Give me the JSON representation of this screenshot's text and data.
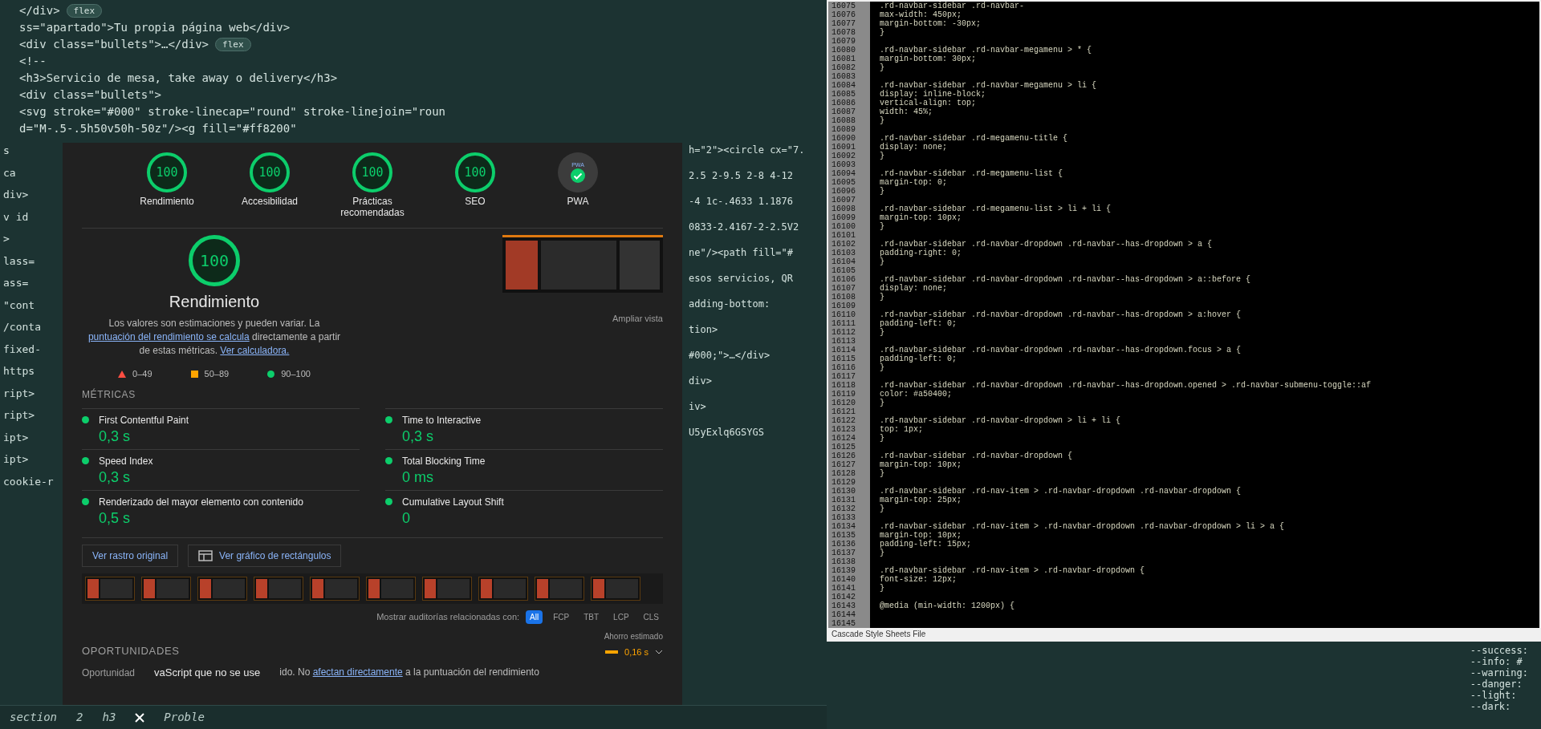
{
  "background_editor": {
    "top_lines": [
      {
        "code": "</div>",
        "badge": "flex"
      },
      {
        "code": "ss=\"apartado\">Tu propia página web</div>"
      },
      {
        "code": "<div class=\"bullets\">…</div>",
        "badge": "flex"
      },
      {
        "code": "<!--"
      },
      {
        "code": "<h3>Servicio de mesa, take away o delivery</h3>"
      },
      {
        "code": "<div class=\"bullets\">"
      },
      {
        "code": "<svg stroke=\"#000\" stroke-linecap=\"round\" stroke-linejoin=\"roun"
      },
      {
        "code": "d=\"M-.5-.5h50v50h-50z\"/><g fill=\"#ff8200\""
      }
    ],
    "left_fragments": [
      "s",
      "ca",
      "div>",
      "v id",
      ">",
      "lass=",
      "ass=",
      "\"cont",
      "/conta",
      "fixed-",
      "https",
      "ript>",
      "ript>",
      "ipt>",
      "ipt>",
      "cookie-r"
    ],
    "middle_fragments": [
      "h=\"2\"><circle cx=\"7.",
      "2.5 2-9.5 2-8 4-12",
      "-4 1c-.4633 1.1876",
      "0833-2.4167-2-2.5V2",
      "ne\"/><path fill=\"#",
      "esos servicios, QR",
      "adding-bottom:",
      "tion>",
      "#000;\">…</div>",
      "div>",
      "iv>",
      "U5yExlq6GSYGS"
    ],
    "bottom_bar": {
      "crumbs": [
        "section",
        "2",
        "h3"
      ],
      "panel_tab": "Proble"
    },
    "css_vars": [
      "--success:",
      "--info: #",
      "--warning:",
      "--danger:",
      "--light:",
      "--dark:"
    ]
  },
  "lighthouse": {
    "gauges": [
      {
        "kind": "score",
        "score": "100",
        "label": "Rendimiento"
      },
      {
        "kind": "score",
        "score": "100",
        "label": "Accesibilidad"
      },
      {
        "kind": "score",
        "score": "100",
        "label": "Prácticas recomendadas"
      },
      {
        "kind": "score",
        "score": "100",
        "label": "SEO"
      },
      {
        "kind": "pwa",
        "badge": "PWA",
        "label": "PWA"
      }
    ],
    "main": {
      "score": "100",
      "title": "Rendimiento",
      "description": [
        {
          "text": "Los valores son estimaciones y pueden variar. La ",
          "link": false
        },
        {
          "text": "puntuación del rendimiento se calcula",
          "link": true
        },
        {
          "text": " directamente a partir de estas métricas. ",
          "link": false
        },
        {
          "text": "Ver calculadora.",
          "link": true
        }
      ],
      "legend": [
        {
          "kind": "fail",
          "range": "0–49"
        },
        {
          "kind": "average",
          "range": "50–89"
        },
        {
          "kind": "pass",
          "range": "90–100"
        }
      ],
      "expand_link": "Ampliar vista"
    },
    "metrics_heading": "MÉTRICAS",
    "metrics": [
      {
        "label": "First Contentful Paint",
        "value": "0,3 s",
        "color": "#0cce6b"
      },
      {
        "label": "Time to Interactive",
        "value": "0,3 s",
        "color": "#0cce6b"
      },
      {
        "label": "Speed Index",
        "value": "0,3 s",
        "color": "#0cce6b"
      },
      {
        "label": "Total Blocking Time",
        "value": "0 ms",
        "color": "#0cce6b"
      },
      {
        "label": "Renderizado del mayor elemento con contenido",
        "value": "0,5 s",
        "color": "#0cce6b"
      },
      {
        "label": "Cumulative Layout Shift",
        "value": "0",
        "color": "#0cce6b"
      }
    ],
    "buttons": [
      {
        "label": "Ver rastro original",
        "kind": "plain"
      },
      {
        "label": "Ver gráfico de rectángulos",
        "kind": "treemap"
      }
    ],
    "filter_label": "Mostrar auditorías relacionadas con:",
    "filters": [
      {
        "label": "All",
        "selected": true
      },
      {
        "label": "FCP",
        "selected": false
      },
      {
        "label": "TBT",
        "selected": false
      },
      {
        "label": "LCP",
        "selected": false
      },
      {
        "label": "CLS",
        "selected": false
      }
    ],
    "savings_heading": "Ahorro estimado",
    "savings_value": "0,16 s",
    "opportunities_heading": "OPORTUNIDADES",
    "column_heading": "Oportunidad",
    "audit_title": "vaScript que no se use",
    "audit_note": [
      {
        "text": "ido. No ",
        "link": false
      },
      {
        "text": "afectan directamente",
        "link": true
      },
      {
        "text": " a la puntuación del rendimiento",
        "link": false
      }
    ]
  },
  "css_editor": {
    "lines": [
      {
        "n": "16075",
        "code": ".rd-navbar-sidebar .rd-navbar-"
      },
      {
        "n": "16076",
        "code": "max-width: 450px;"
      },
      {
        "n": "16077",
        "code": "margin-bottom: -30px;"
      },
      {
        "n": "16078",
        "code": "}"
      },
      {
        "n": "16079"
      },
      {
        "n": "16080",
        "code": ".rd-navbar-sidebar .rd-navbar-megamenu > * {"
      },
      {
        "n": "16081",
        "code": "margin-bottom: 30px;"
      },
      {
        "n": "16082",
        "code": "}"
      },
      {
        "n": "16083"
      },
      {
        "n": "16084",
        "code": ".rd-navbar-sidebar .rd-navbar-megamenu > li {"
      },
      {
        "n": "16085",
        "code": "display: inline-block;"
      },
      {
        "n": "16086",
        "code": "vertical-align: top;"
      },
      {
        "n": "16087",
        "code": "width: 45%;"
      },
      {
        "n": "16088",
        "code": "}"
      },
      {
        "n": "16089"
      },
      {
        "n": "16090",
        "code": ".rd-navbar-sidebar .rd-megamenu-title {"
      },
      {
        "n": "16091",
        "code": "display: none;"
      },
      {
        "n": "16092",
        "code": "}"
      },
      {
        "n": "16093"
      },
      {
        "n": "16094",
        "code": ".rd-navbar-sidebar .rd-megamenu-list {"
      },
      {
        "n": "16095",
        "code": "margin-top: 0;"
      },
      {
        "n": "16096",
        "code": "}"
      },
      {
        "n": "16097"
      },
      {
        "n": "16098",
        "code": ".rd-navbar-sidebar .rd-megamenu-list > li + li {"
      },
      {
        "n": "16099",
        "code": "margin-top: 10px;"
      },
      {
        "n": "16100",
        "code": "}"
      },
      {
        "n": "16101"
      },
      {
        "n": "16102",
        "code": ".rd-navbar-sidebar .rd-navbar-dropdown .rd-navbar--has-dropdown > a {"
      },
      {
        "n": "16103",
        "code": "padding-right: 0;"
      },
      {
        "n": "16104",
        "code": "}"
      },
      {
        "n": "16105"
      },
      {
        "n": "16106",
        "code": ".rd-navbar-sidebar .rd-navbar-dropdown .rd-navbar--has-dropdown > a::before {"
      },
      {
        "n": "16107",
        "code": "display: none;"
      },
      {
        "n": "16108",
        "code": "}"
      },
      {
        "n": "16109"
      },
      {
        "n": "16110",
        "code": ".rd-navbar-sidebar .rd-navbar-dropdown .rd-navbar--has-dropdown > a:hover {"
      },
      {
        "n": "16111",
        "code": "padding-left: 0;"
      },
      {
        "n": "16112",
        "code": "}"
      },
      {
        "n": "16113"
      },
      {
        "n": "16114",
        "code": ".rd-navbar-sidebar .rd-navbar-dropdown .rd-navbar--has-dropdown.focus > a {"
      },
      {
        "n": "16115",
        "code": "padding-left: 0;"
      },
      {
        "n": "16116",
        "code": "}"
      },
      {
        "n": "16117"
      },
      {
        "n": "16118",
        "code": ".rd-navbar-sidebar .rd-navbar-dropdown .rd-navbar--has-dropdown.opened > .rd-navbar-submenu-toggle::af"
      },
      {
        "n": "16119",
        "code": "color: #a50400;"
      },
      {
        "n": "16120",
        "code": "}"
      },
      {
        "n": "16121"
      },
      {
        "n": "16122",
        "code": ".rd-navbar-sidebar .rd-navbar-dropdown > li + li {"
      },
      {
        "n": "16123",
        "code": "top: 1px;"
      },
      {
        "n": "16124",
        "code": "}"
      },
      {
        "n": "16125"
      },
      {
        "n": "16126",
        "code": ".rd-navbar-sidebar .rd-navbar-dropdown {"
      },
      {
        "n": "16127",
        "code": "margin-top: 10px;"
      },
      {
        "n": "16128",
        "code": "}"
      },
      {
        "n": "16129"
      },
      {
        "n": "16130",
        "code": ".rd-navbar-sidebar .rd-nav-item > .rd-navbar-dropdown .rd-navbar-dropdown {"
      },
      {
        "n": "16131",
        "code": "margin-top: 25px;"
      },
      {
        "n": "16132",
        "code": "}"
      },
      {
        "n": "16133"
      },
      {
        "n": "16134",
        "code": ".rd-navbar-sidebar .rd-nav-item > .rd-navbar-dropdown .rd-navbar-dropdown > li > a {"
      },
      {
        "n": "16135",
        "code": "margin-top: 10px;"
      },
      {
        "n": "16136",
        "code": "padding-left: 15px;"
      },
      {
        "n": "16137",
        "code": "}"
      },
      {
        "n": "16138"
      },
      {
        "n": "16139",
        "code": ".rd-navbar-sidebar .rd-nav-item > .rd-navbar-dropdown {"
      },
      {
        "n": "16140",
        "code": "font-size: 12px;"
      },
      {
        "n": "16141",
        "code": "}"
      },
      {
        "n": "16142"
      },
      {
        "n": "16143",
        "code": "@media (min-width: 1200px) {"
      },
      {
        "n": "16144"
      },
      {
        "n": "16145"
      }
    ],
    "status": "Cascade Style Sheets File"
  }
}
